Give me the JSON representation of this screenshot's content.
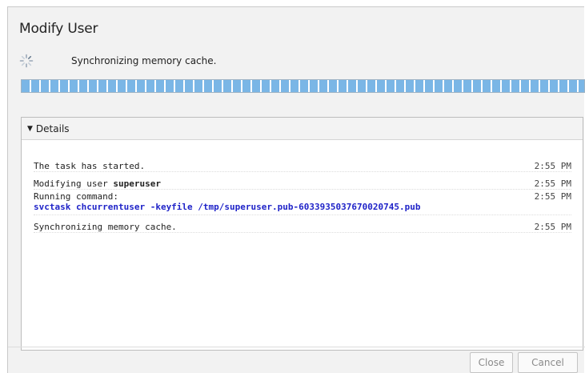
{
  "dialog": {
    "title": "Modify User",
    "status": "Synchronizing memory cache.",
    "progress_percent": 100
  },
  "details": {
    "header": "Details",
    "log": [
      {
        "text": "The task has started.",
        "time": "2:55 PM"
      },
      {
        "prefix": "Modifying user ",
        "bold": "superuser",
        "time": "2:55 PM"
      },
      {
        "text": "Running command:",
        "time": "2:55 PM",
        "command": "svctask chcurrentuser -keyfile /tmp/superuser.pub-6033935037670020745.pub"
      },
      {
        "text": "Synchronizing memory cache.",
        "time": "2:55 PM"
      }
    ]
  },
  "buttons": {
    "close": "Close",
    "cancel": "Cancel"
  },
  "colors": {
    "progress": "#7ab6e6",
    "command": "#1f23c8"
  }
}
